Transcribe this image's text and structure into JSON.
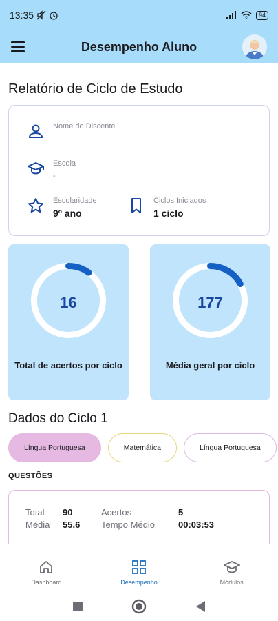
{
  "status_bar": {
    "time": "13:35",
    "battery": "94"
  },
  "app_bar": {
    "title": "Desempenho Aluno"
  },
  "report": {
    "title": "Relatório de Ciclo de Estudo",
    "student": {
      "label": "Nome do Discente",
      "value": ""
    },
    "school": {
      "label": "Escola",
      "value": "-"
    },
    "schooling": {
      "label": "Escolaridade",
      "value": "9º ano"
    },
    "cycles": {
      "label": "Ciclos Iniciados",
      "value": "1 ciclo"
    }
  },
  "stats": [
    {
      "value": "16",
      "caption": "Total de acertos por ciclo",
      "progress": 0.1
    },
    {
      "value": "177",
      "caption": "Média geral por ciclo",
      "progress": 0.17
    }
  ],
  "cycle": {
    "title": "Dados do Ciclo 1",
    "chips": [
      "Língua Portuguesa",
      "Matemática",
      "Língua Portuguesa"
    ],
    "section_label": "QUESTÕES",
    "questions": {
      "total_label": "Total",
      "total_value": "90",
      "hits_label": "Acertos",
      "hits_value": "5",
      "avg_label": "Média",
      "avg_value": "55.6",
      "time_label": "Tempo Médio",
      "time_value": "00:03:53"
    }
  },
  "bottom_nav": [
    {
      "label": "Dashboard",
      "icon": "home-icon"
    },
    {
      "label": "Desempenho",
      "icon": "grid-icon"
    },
    {
      "label": "Módulos",
      "icon": "graduation-cap-icon"
    }
  ],
  "colors": {
    "header": "#a7dcfb",
    "card": "#bfe4fb",
    "accent": "#1a47a0",
    "active_chip": "#e6b9e3",
    "nav_active": "#1a6fbf"
  }
}
